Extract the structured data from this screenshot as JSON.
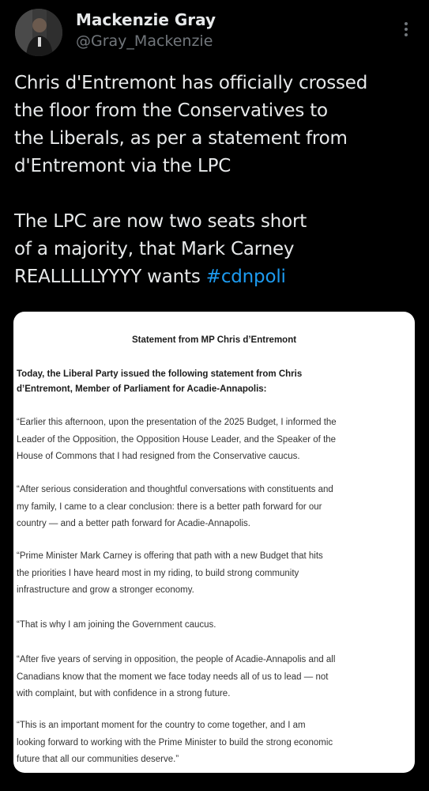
{
  "author": {
    "name": "Mackenzie Gray",
    "handle": "@Gray_Mackenzie",
    "avatar_icon": "profile-photo"
  },
  "menu_icon": "more-vertical-icon",
  "tweet": {
    "lines": [
      "Chris d'Entremont has officially crossed",
      "the floor from the Conservatives to",
      "the Liberals, as per a statement from",
      "d'Entremont via the LPC",
      "The LPC are now two seats short",
      "of a majority, that Mark Carney",
      "REALLLLLYYYY wants "
    ],
    "hashtag": "#cdnpoli"
  },
  "statement": {
    "title": "Statement from MP Chris d’Entremont",
    "intro": [
      "Today, the Liberal Party issued the following statement from Chris",
      "d’Entremont, Member of Parliament for Acadie-Annapolis:"
    ],
    "paragraphs": [
      [
        "“Earlier this afternoon, upon the presentation of the 2025 Budget, I informed the",
        "Leader of the Opposition, the Opposition House Leader, and the Speaker of the",
        "House of Commons that I had resigned from the Conservative caucus."
      ],
      [
        "“After serious consideration and thoughtful conversations with constituents and",
        "my family, I came to a clear conclusion: there is a better path forward for our",
        "country — and a better path forward for Acadie-Annapolis."
      ],
      [
        "“Prime Minister Mark Carney is offering that path with a new Budget that hits",
        "the priorities I have heard most in my riding, to build strong community",
        "infrastructure and grow a stronger economy."
      ],
      [
        "“That is why I am joining the Government caucus."
      ],
      [
        "“After five years of serving in opposition, the people of Acadie-Annapolis and all",
        "Canadians know that the moment we face today needs all of us to lead — not",
        "with complaint, but with confidence in a strong future."
      ],
      [
        "“This is an important moment for the country to come together, and I am",
        "looking forward to working with the Prime Minister to build the strong economic",
        "future that all our communities deserve.”"
      ]
    ]
  }
}
